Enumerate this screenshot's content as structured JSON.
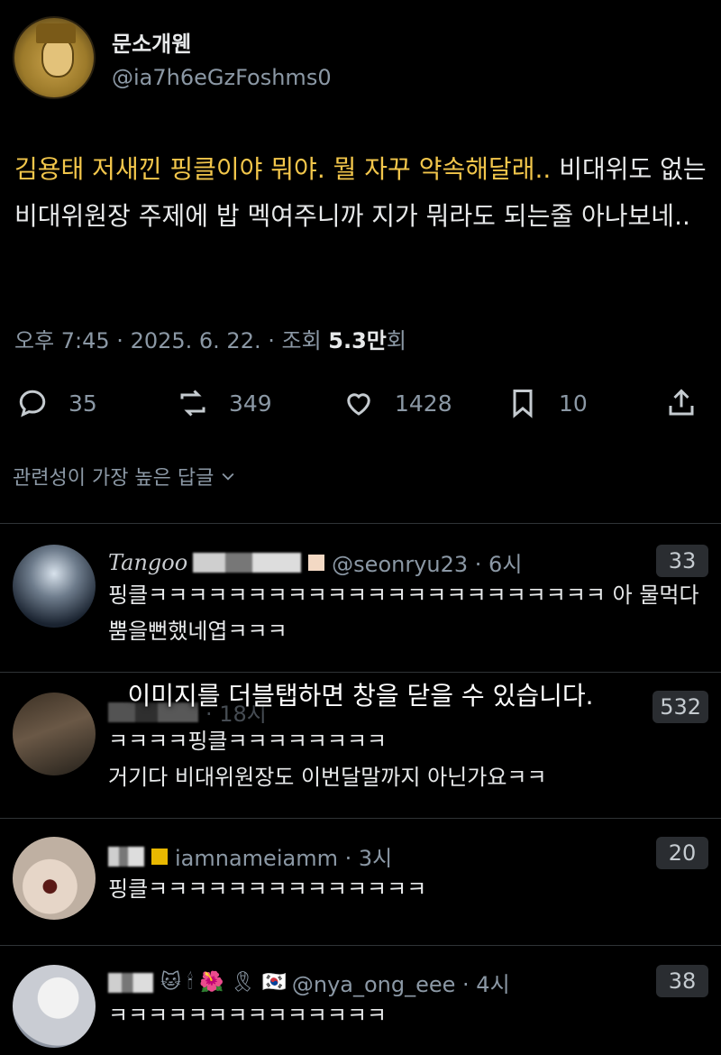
{
  "post": {
    "display_name": "문소개웬",
    "handle": "@ia7h6eGzFoshms0",
    "text_highlight": "김용태 저새낀 핑클이야 뭐야. 뭘 자꾸 약속해달래..",
    "text_rest": " 비대위도 없는 비대위원장 주제에 밥 멕여주니까 지가 뭐라도 되는줄 아나보네..",
    "meta_time": "오후 7:45 · 2025. 6. 22. · 조회 ",
    "meta_views": "5.3만",
    "meta_suffix": "회",
    "actions": {
      "reply_count": "35",
      "repost_count": "349",
      "like_count": "1428",
      "bookmark_count": "10"
    },
    "accent_color": "#f2c64b"
  },
  "sort_label": "관련성이 가장 높은 답글",
  "overlay_message": "이미지를 더블탭하면 창을 닫을 수 있습니다.",
  "replies": [
    {
      "name_partial": "Tangoo",
      "handle_time": "@seonryu23 · 6시",
      "text": "핑클ㅋㅋㅋㅋㅋㅋㅋㅋㅋㅋㅋㅋㅋㅋㅋㅋㅋㅋㅋㅋㅋㅋㅋ 아 물먹다 뿜을뻔했네엽ㅋㅋㅋ",
      "badge": "33"
    },
    {
      "name_partial": "",
      "handle_time": "· 18시",
      "text_line1": "ㅋㅋㅋㅋ핑클ㅋㅋㅋㅋㅋㅋㅋㅋ",
      "text_line2": "거기다 비대위원장도 이번달말까지 아닌가요ㅋㅋ",
      "badge": "532"
    },
    {
      "name_partial": "",
      "handle_time": "iamnameiamm · 3시",
      "text": "핑클ㅋㅋㅋㅋㅋㅋㅋㅋㅋㅋㅋㅋㅋㅋ",
      "badge": "20"
    },
    {
      "name_partial": "",
      "handle_time": "@nya_ong_eee · 4시",
      "emojis": "🐱 🕯 🌺 🎗 🇰🇷",
      "text": "ㅋㅋㅋㅋㅋㅋㅋㅋㅋㅋㅋㅋㅋㅋ",
      "badge": "38"
    }
  ]
}
